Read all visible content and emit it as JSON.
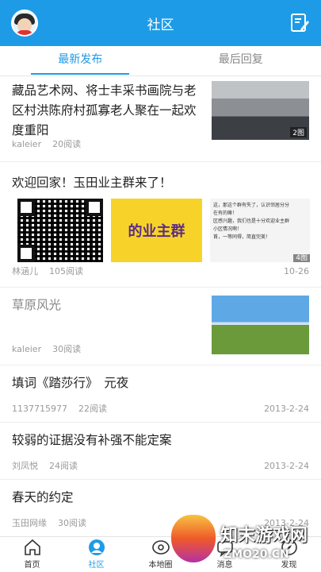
{
  "header": {
    "title": "社区"
  },
  "tabs": [
    {
      "label": "最新发布"
    },
    {
      "label": "最后回复"
    }
  ],
  "posts": [
    {
      "title": "藏品艺术网、将士丰采书画院与老区村洪陈府村孤寡老人聚在一起欢度重阳",
      "author": "kaleier",
      "reads": "20阅读",
      "image_count": "2图"
    },
    {
      "title": "欢迎回家！玉田业主群来了！",
      "author": "林涵儿",
      "reads": "105阅读",
      "date": "10-26",
      "image_count": "4图",
      "banner_text": "的业主群",
      "chat_lines": [
        "这，那这个群有失了，认识邻居分分",
        "在有的嘛！",
        "区感兴趣，我们也是十分欢迎业主群",
        "小区情况啊！",
        "首，一等同得，简直完美！"
      ]
    },
    {
      "title": "草原风光",
      "author": "kaleier",
      "reads": "30阅读"
    },
    {
      "title": "填词《踏莎行》　元夜",
      "author": "1137715977",
      "reads": "22阅读",
      "date": "2013-2-24"
    },
    {
      "title": "较弱的证据没有补强不能定案",
      "author": "刘凤悦",
      "reads": "24阅读",
      "date": "2013-2-24"
    },
    {
      "title": "春天的约定",
      "author": "玉田网缘",
      "reads": "30阅读",
      "date": "2013-2-24"
    }
  ],
  "nav": [
    {
      "label": "首页"
    },
    {
      "label": "社区"
    },
    {
      "label": "本地圈"
    },
    {
      "label": "消息"
    },
    {
      "label": "发现"
    }
  ],
  "watermark": {
    "text": "知末游戏网",
    "url": "ZMO20.CN"
  },
  "colors": {
    "brand": "#1e9be6"
  }
}
